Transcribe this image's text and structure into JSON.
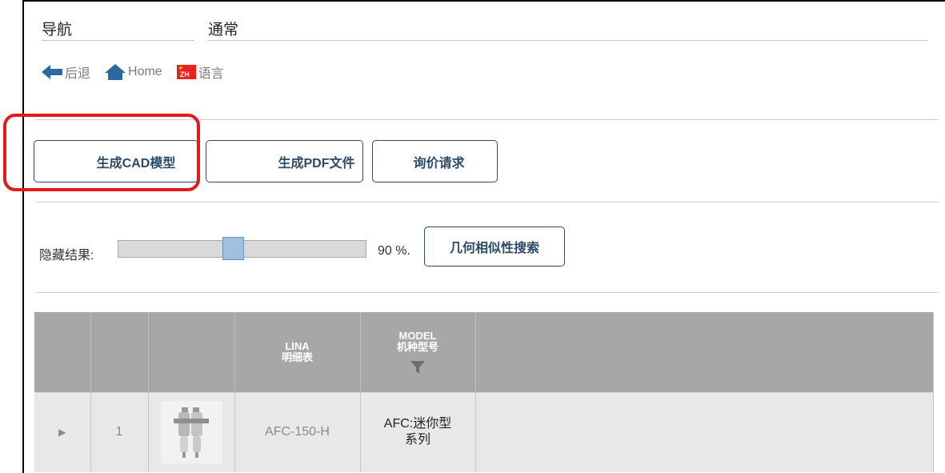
{
  "tabs": {
    "nav": "导航",
    "general": "通常"
  },
  "toolbar": {
    "back": "后退",
    "home": "Home",
    "flag_code": "ZH",
    "language": "语言"
  },
  "actions": {
    "cad": "生成CAD模型",
    "pdf": "生成PDF文件",
    "rfq": "询价请求"
  },
  "filter": {
    "label": "隐藏结果:",
    "value_text": "90 %.",
    "slider_fraction": 0.46,
    "geo_search": "几何相似性搜索"
  },
  "table": {
    "headers": {
      "lina_line1": "LINA",
      "lina_line2": "明细表",
      "model_line1": "MODEL",
      "model_line2": "机种型号"
    },
    "rows": [
      {
        "index": "1",
        "lina": "AFC-150-H",
        "model_line1": "AFC:迷你型",
        "model_line2": "系列"
      }
    ]
  },
  "colors": {
    "accent": "#2d4a66",
    "highlight": "#e21a1a",
    "header_bg": "#a7a7a7",
    "row_bg": "#e8e8e8"
  }
}
